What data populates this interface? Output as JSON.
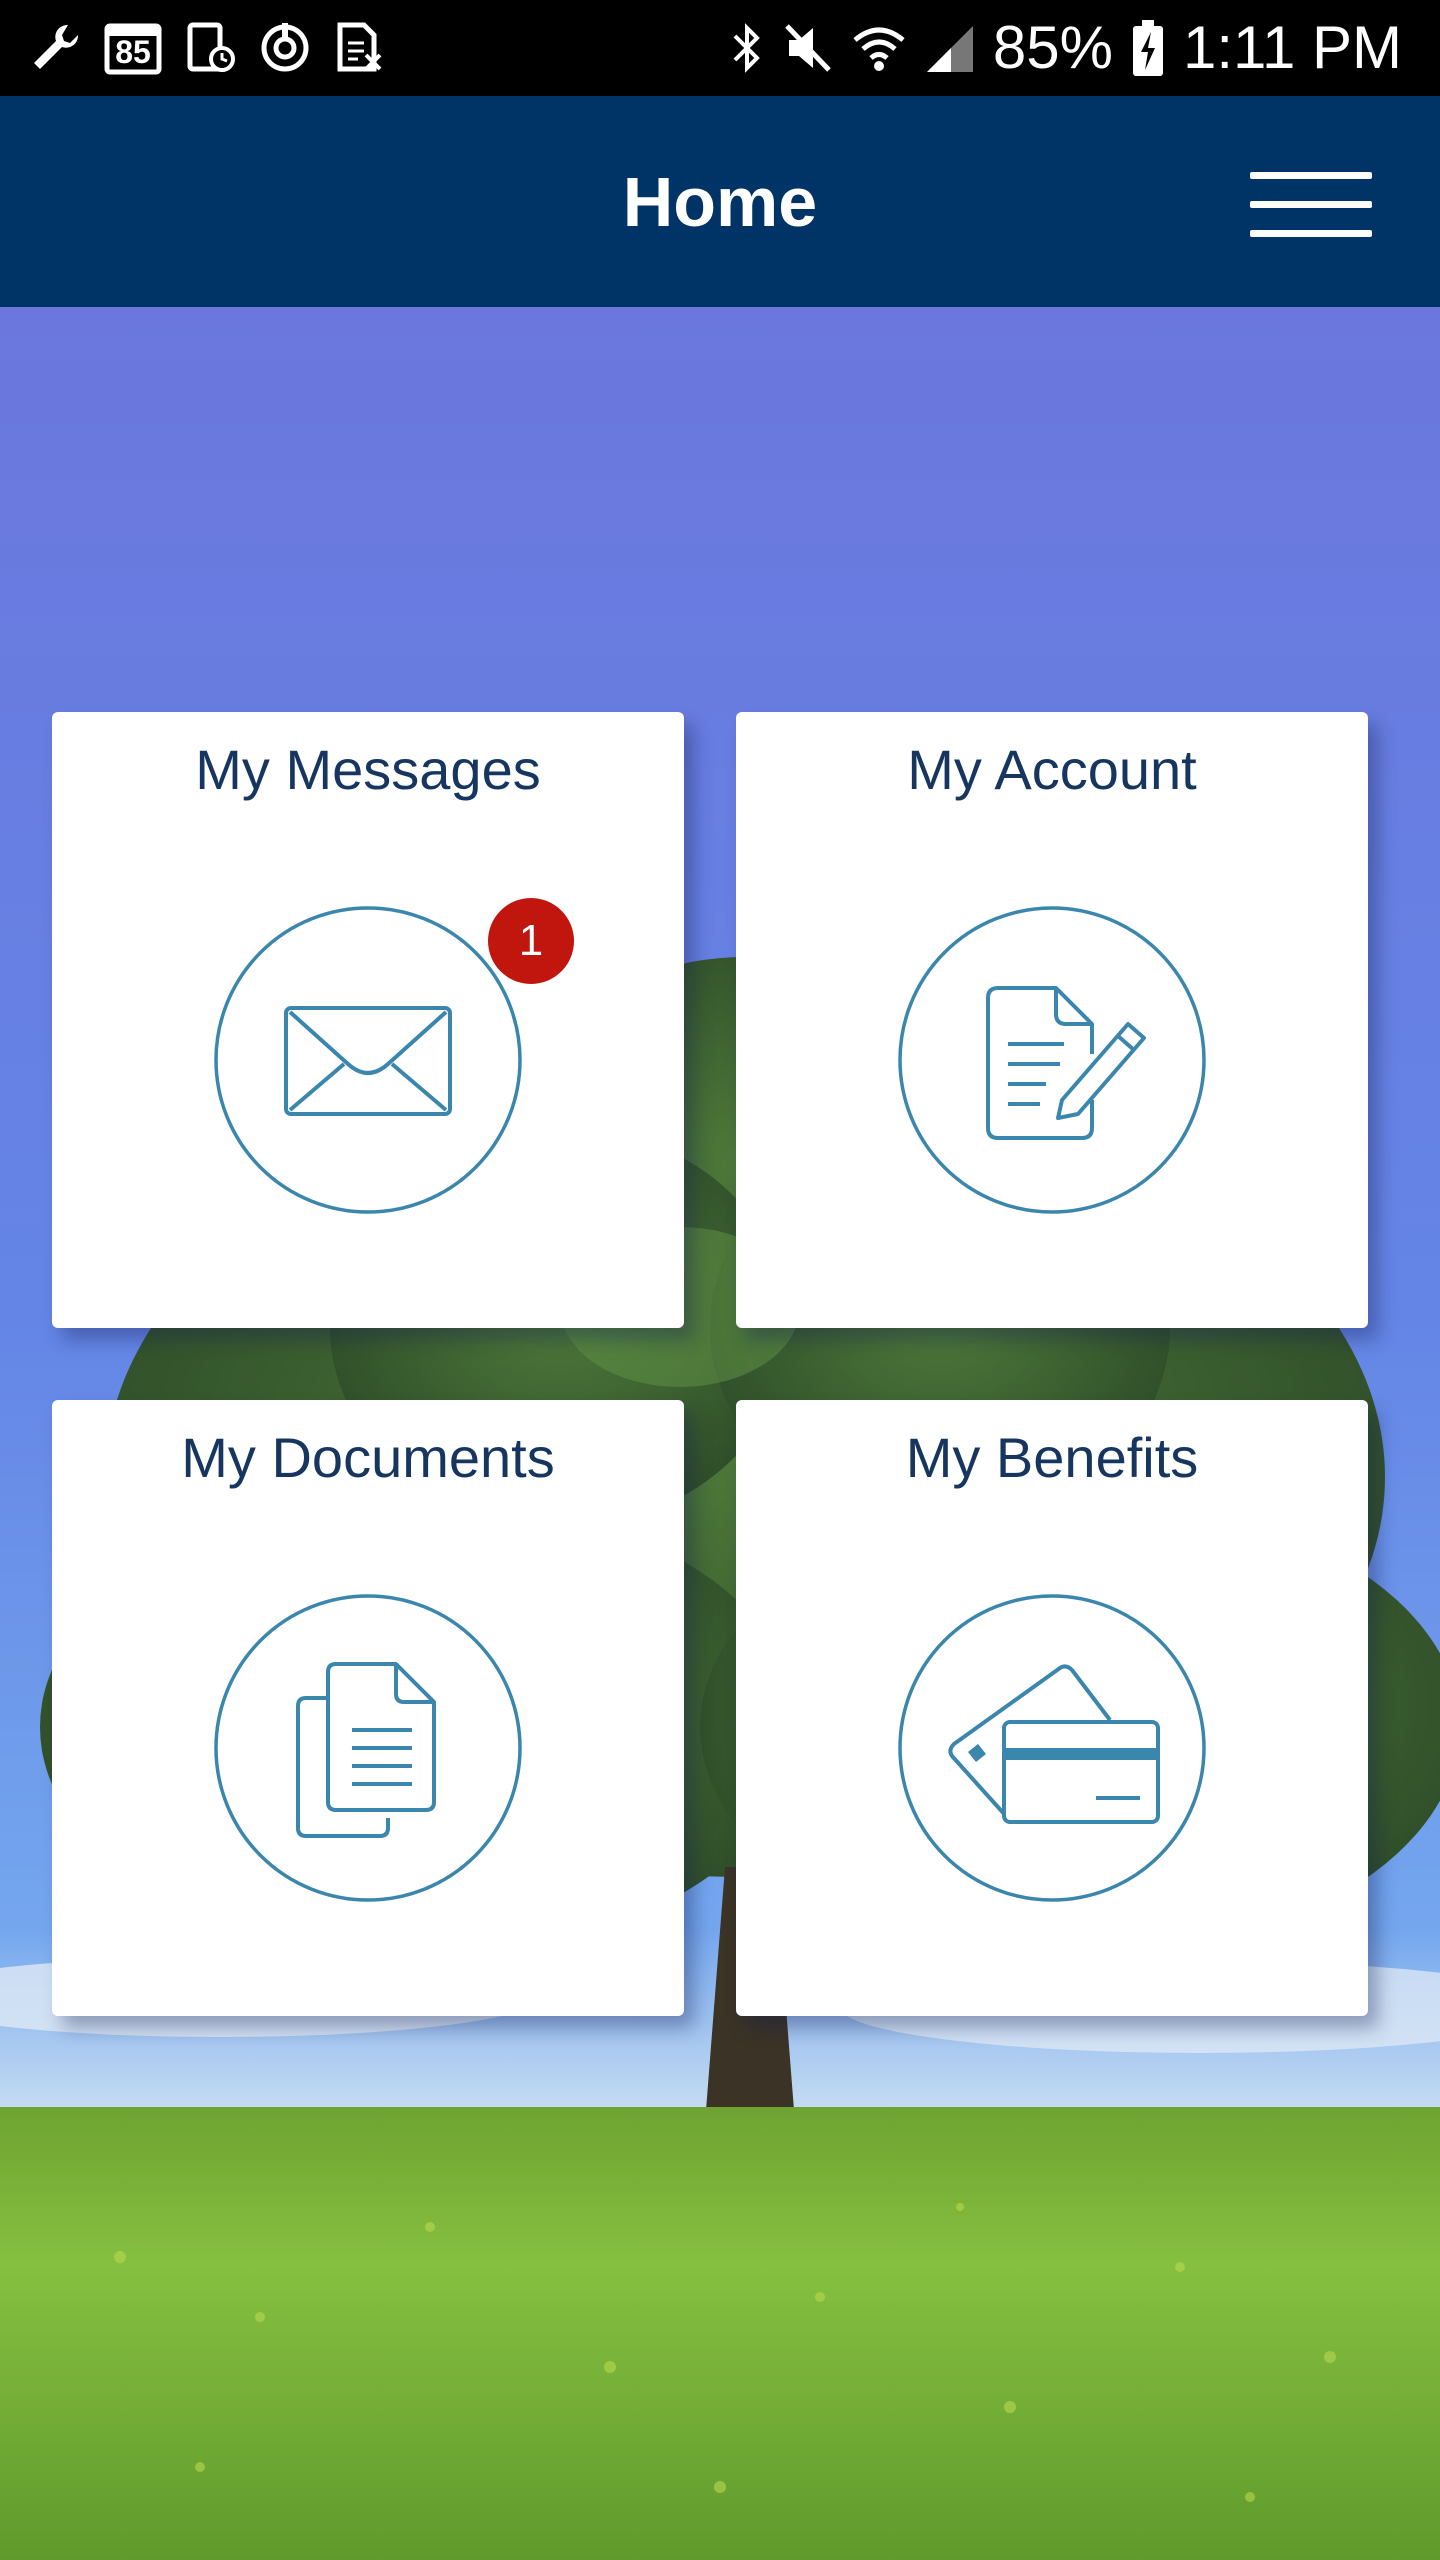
{
  "status_bar": {
    "notification_icons": [
      "wrench-icon",
      "calendar-85-icon",
      "screenshot-icon",
      "sync-icon",
      "sim-icon"
    ],
    "calendar_day": "85",
    "system_icons": [
      "bluetooth-icon",
      "mute-icon",
      "wifi-icon",
      "signal-icon"
    ],
    "battery": "85%",
    "time": "1:11 PM"
  },
  "header": {
    "title": "Home",
    "menu_icon": "hamburger-menu-icon",
    "background_color": "#003366"
  },
  "tiles": [
    {
      "label": "My Messages",
      "icon": "envelope-icon",
      "badge": "1"
    },
    {
      "label": "My Account",
      "icon": "document-edit-icon"
    },
    {
      "label": "My Documents",
      "icon": "documents-icon"
    },
    {
      "label": "My Benefits",
      "icon": "cards-icon"
    }
  ],
  "colors": {
    "header": "#003366",
    "tile_text": "#16365f",
    "icon_stroke": "#3a86ad",
    "badge": "#c0160e",
    "sky": "#6a7fe0",
    "grass": "#7fb93a"
  }
}
